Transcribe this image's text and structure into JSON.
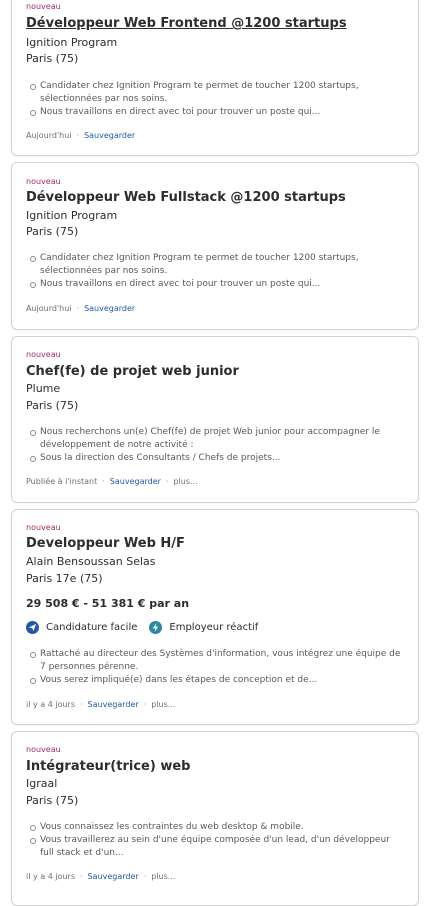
{
  "jobs": [
    {
      "tag": "nouveau",
      "title": "Développeur Web Frontend @1200 startups",
      "company": "Ignition Program",
      "location": "Paris (75)",
      "snippets": [
        "Candidater chez Ignition Program te permet de toucher 1200 startups, sélectionnées par nos soins.",
        "Nous travaillons en direct avec toi pour trouver un poste qui..."
      ],
      "date": "Aujourd'hui",
      "save": "Sauvegarder"
    },
    {
      "tag": "nouveau",
      "title": "Développeur Web Fullstack @1200 startups",
      "company": "Ignition Program",
      "location": "Paris (75)",
      "snippets": [
        "Candidater chez Ignition Program te permet de toucher 1200 startups, sélectionnées par nos soins.",
        "Nous travaillons en direct avec toi pour trouver un poste qui..."
      ],
      "date": "Aujourd'hui",
      "save": "Sauvegarder"
    },
    {
      "tag": "nouveau",
      "title": "Chef(fe) de projet web junior",
      "company": "Plume",
      "location": "Paris (75)",
      "snippets": [
        "Nous recherchons un(e) Chef(fe) de projet Web junior pour accompagner le développement de notre activité :",
        "Sous la direction des Consultants / Chefs de projets..."
      ],
      "date": "Publiée à l'instant",
      "save": "Sauvegarder",
      "more": "plus..."
    },
    {
      "tag": "nouveau",
      "title": "Developpeur Web H/F",
      "company": "Alain Bensoussan Selas",
      "location": "Paris 17e (75)",
      "salary": "29 508 € - 51 381 € par an",
      "badges": [
        "Candidature facile",
        "Employeur réactif"
      ],
      "badge_colors": [
        "#2557a7",
        "#2b8a9f"
      ],
      "snippets": [
        "Rattaché au directeur des Systèmes d'information, vous intégrez une équipe de 7 personnes pérenne.",
        "Vous serez impliqué(e) dans les étapes de conception et de..."
      ],
      "date": "il y a 4 jours",
      "save": "Sauvegarder",
      "more": "plus..."
    },
    {
      "tag": "nouveau",
      "title": "Intégrateur(trice) web",
      "company": "Igraal",
      "location": "Paris (75)",
      "snippets": [
        "Vous connaissez les contraintes du web desktop & mobile.",
        "Vous travaillerez au sein d'une équipe composée d'un lead, d'un développeur full stack et d'un..."
      ],
      "date": "il y a 4 jours",
      "save": "Sauvegarder",
      "more": "plus..."
    }
  ],
  "colors": {
    "new_tag": "#9d2b6b",
    "link": "#2557a7",
    "border": "#d4d2d0"
  }
}
